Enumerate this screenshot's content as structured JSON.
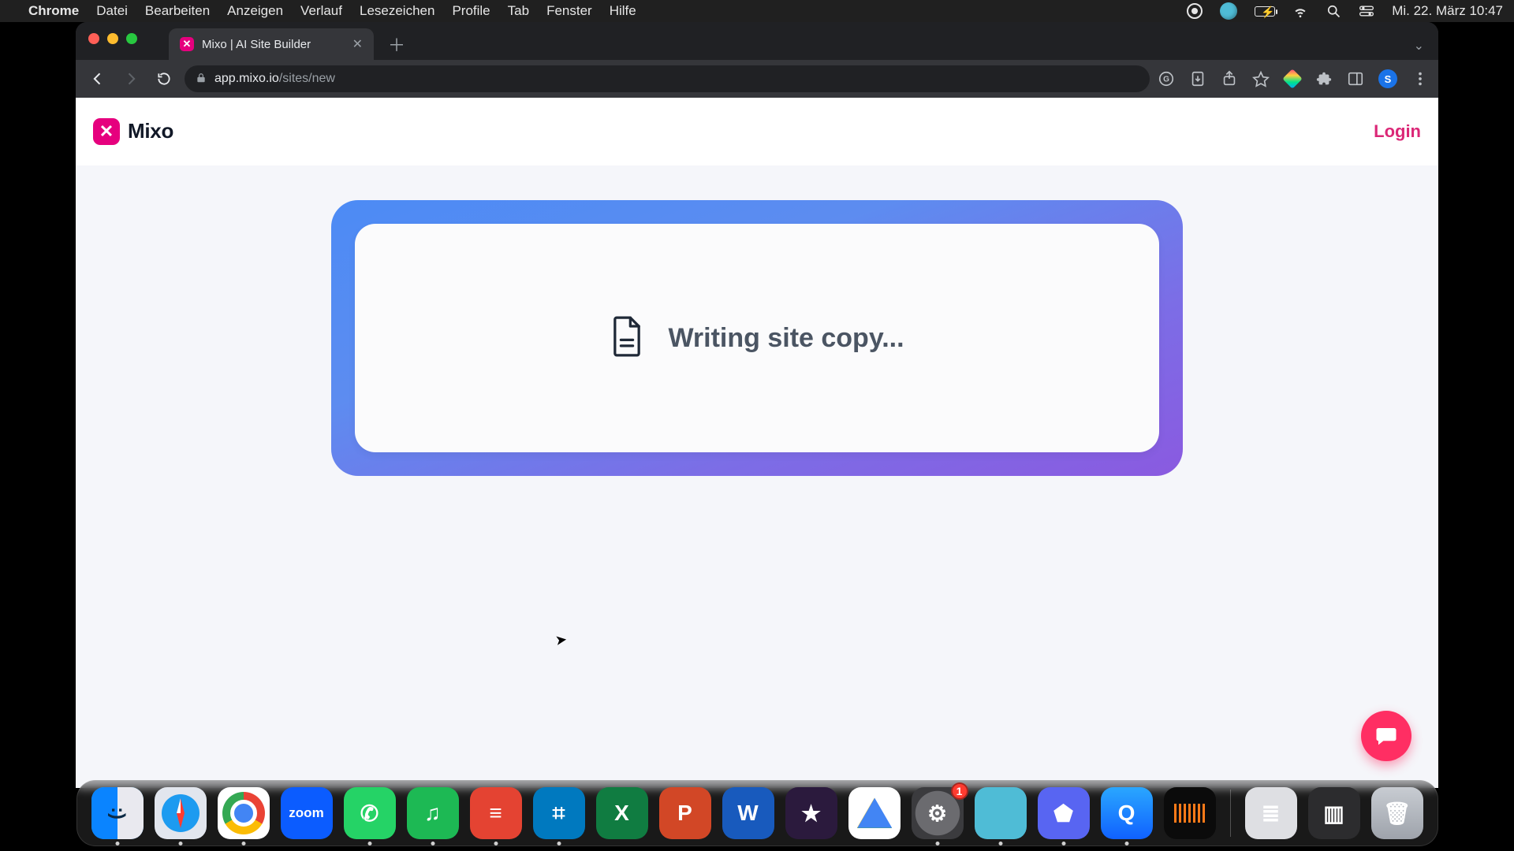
{
  "menubar": {
    "app": "Chrome",
    "items": [
      "Datei",
      "Bearbeiten",
      "Anzeigen",
      "Verlauf",
      "Lesezeichen",
      "Profile",
      "Tab",
      "Fenster",
      "Hilfe"
    ],
    "clock": "Mi. 22. März  10:47"
  },
  "chrome": {
    "tab_title": "Mixo | AI Site Builder",
    "url_host": "app.mixo.io",
    "url_path": "/sites/new",
    "profile_initial": "S"
  },
  "page": {
    "brand": "Mixo",
    "login": "Login",
    "status": "Writing site copy..."
  },
  "dock": {
    "apps": [
      {
        "name": "finder",
        "label": "F",
        "running": true
      },
      {
        "name": "safari",
        "label": "",
        "running": true
      },
      {
        "name": "chrome",
        "label": "",
        "running": true
      },
      {
        "name": "zoom",
        "label": "zoom",
        "running": false
      },
      {
        "name": "whatsapp",
        "label": "✆",
        "running": true
      },
      {
        "name": "spotify",
        "label": "♫",
        "running": true
      },
      {
        "name": "todoist",
        "label": "≡",
        "running": true
      },
      {
        "name": "trello",
        "label": "⌗",
        "running": true
      },
      {
        "name": "excel",
        "label": "X",
        "running": false
      },
      {
        "name": "powerpoint",
        "label": "P",
        "running": false
      },
      {
        "name": "word",
        "label": "W",
        "running": false
      },
      {
        "name": "imovie",
        "label": "★",
        "running": false
      },
      {
        "name": "drive",
        "label": "",
        "running": false
      },
      {
        "name": "settings",
        "label": "⚙",
        "running": true,
        "badge": "1"
      },
      {
        "name": "circle-app",
        "label": "",
        "running": true
      },
      {
        "name": "discord",
        "label": "⬟",
        "running": true
      },
      {
        "name": "quicktime",
        "label": "Q",
        "running": true
      },
      {
        "name": "voice-memos",
        "label": "",
        "running": false
      }
    ],
    "right": [
      {
        "name": "drawer",
        "label": "≣"
      },
      {
        "name": "mini",
        "label": "▥"
      },
      {
        "name": "trash",
        "label": "🗑"
      }
    ]
  }
}
